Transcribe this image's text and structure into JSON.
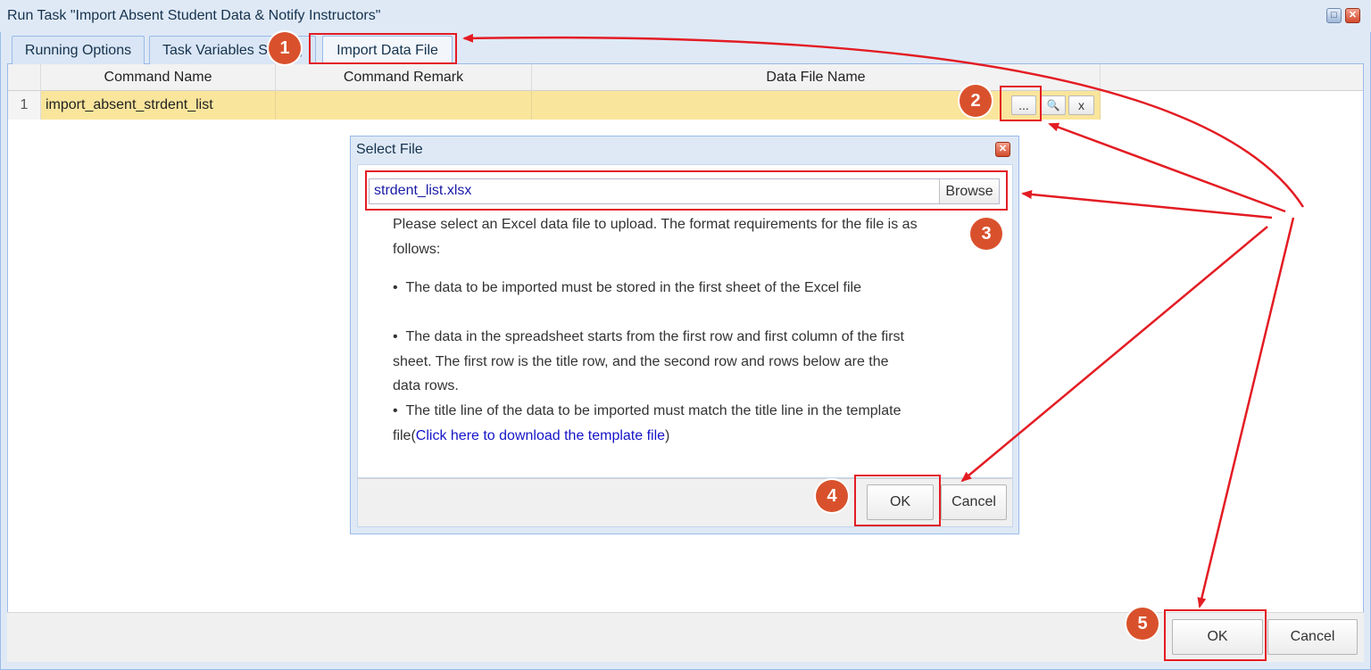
{
  "window": {
    "title": "Run Task \"Import Absent Student Data & Notify Instructors\"",
    "restore_glyph": "□",
    "close_glyph": "✕"
  },
  "tabs": [
    {
      "label": "Running Options"
    },
    {
      "label": "Task Variables Setting"
    },
    {
      "label": "Import Data File",
      "active": true
    }
  ],
  "grid": {
    "columns": [
      "Command Name",
      "Command Remark",
      "Data File Name"
    ],
    "rows": [
      {
        "index": "1",
        "command_name": "import_absent_strdent_list",
        "command_remark": "",
        "data_file_name": ""
      }
    ],
    "row_buttons": {
      "select": "...",
      "preview": "🔍",
      "clear": "x"
    }
  },
  "footer": {
    "ok": "OK",
    "cancel": "Cancel"
  },
  "dialog": {
    "title": "Select File",
    "file_value": "strdent_list.xlsx",
    "browse": "Browse",
    "intro": "Please select an Excel data file to upload. The format requirements for the file is as follows:",
    "bullets": [
      "The data to be imported must be stored in the first sheet of the Excel file",
      "The data in the spreadsheet starts from the first row and first column of the first sheet. The first row is the title row, and the second row and rows below are the data rows.",
      "The title line of the data to be imported must match the title line in the template file"
    ],
    "bullet3_prefix": "The title line of the data to be imported must match the title line in the template file(",
    "template_link": "Click here to download the template file",
    "bullet3_suffix": ")",
    "ok": "OK",
    "cancel": "Cancel"
  },
  "annotations": {
    "badges": [
      "1",
      "2",
      "3",
      "4",
      "5"
    ],
    "accent": "#d9512c",
    "highlight": "#e31c23"
  },
  "colors": {
    "window_bg": "#dfe9f6",
    "row_highlight": "#fae59c",
    "border": "#99bbe8"
  }
}
